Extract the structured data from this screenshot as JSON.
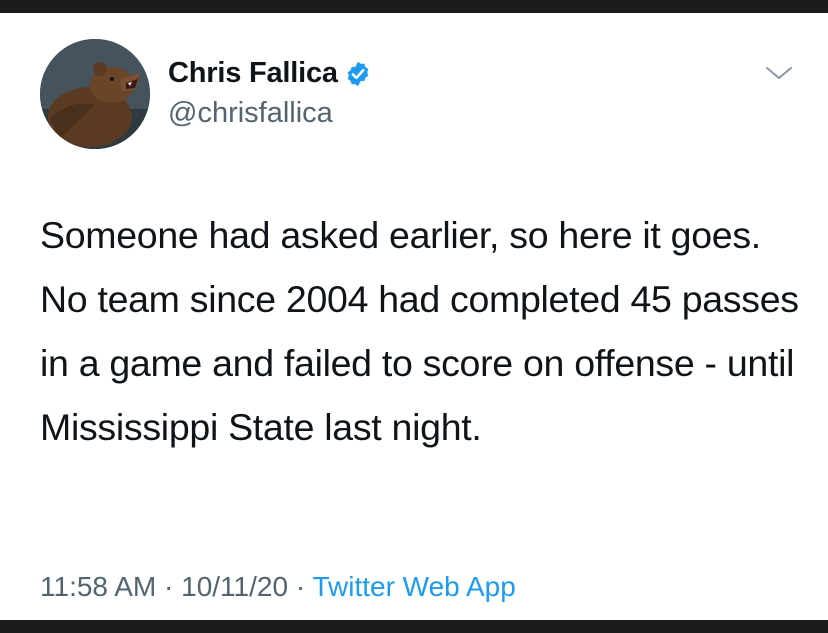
{
  "tweet": {
    "display_name": "Chris Fallica",
    "handle": "@chrisfallica",
    "text": "Someone had asked earlier, so here it goes. No team since 2004 had completed 45 passes in a game and failed to score on offense - until Mississippi State last night.",
    "time": "11:58 AM",
    "separator": "·",
    "date": "10/11/20",
    "source": "Twitter Web App"
  },
  "icons": {
    "verified": "verified-badge-icon",
    "menu": "chevron-down-icon",
    "avatar": "bear-avatar"
  },
  "colors": {
    "text": "#0f1419",
    "secondary": "#536471",
    "link": "#1d9bf0",
    "verified": "#1d9bf0"
  }
}
